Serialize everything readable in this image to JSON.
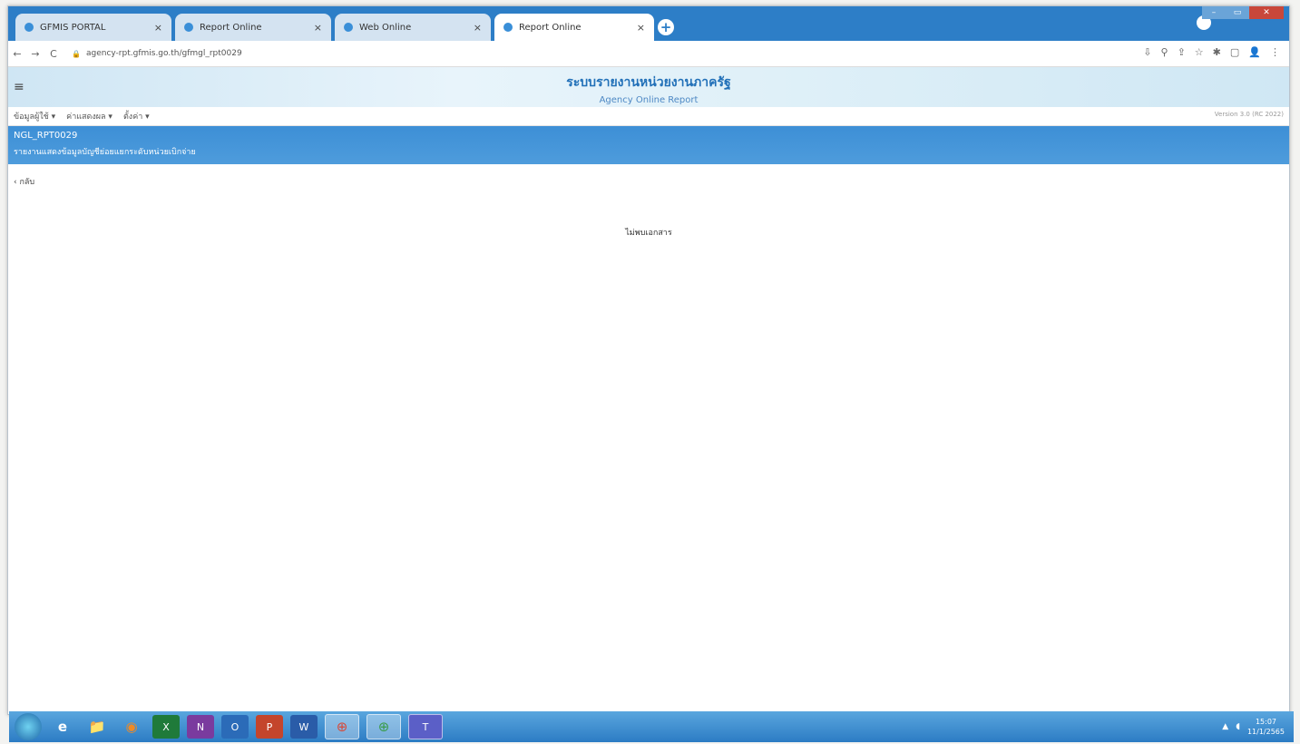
{
  "browser": {
    "tabs": [
      {
        "label": "GFMIS PORTAL",
        "active": false
      },
      {
        "label": "Report Online",
        "active": false
      },
      {
        "label": "Web Online",
        "active": false
      },
      {
        "label": "Report Online",
        "active": true
      }
    ],
    "tab_close": "×",
    "new_tab": "+",
    "url": "agency-rpt.gfmis.go.th/gfmgl_rpt0029",
    "nav": {
      "back": "←",
      "forward": "→",
      "reload": "C"
    },
    "lock_icon": "🔒",
    "toolbar_icons": [
      "⇩",
      "⚲",
      "⇪",
      "☆",
      "✱",
      "▢",
      "👤",
      "⋮"
    ],
    "window_controls": {
      "min": "–",
      "max": "▭",
      "close": "✕"
    }
  },
  "app": {
    "menu_icon": "≡",
    "title": "ระบบรายงานหน่วยงานภาครัฐ",
    "subtitle": "Agency Online Report",
    "menu": [
      "ข้อมูลผู้ใช้ ▾",
      "ค่าแสดงผล ▾",
      "ตั้งค่า ▾"
    ],
    "version": "Version 3.0 (RC 2022)",
    "report_code": "NGL_RPT0029",
    "report_name": "รายงานแสดงข้อมูลบัญชีย่อยแยกระดับหน่วยเบิกจ่าย",
    "back_label": "‹ กลับ",
    "empty_message": "ไม่พบเอกสาร"
  },
  "taskbar": {
    "apps": [
      "e",
      "📁",
      "◉",
      "X",
      "N",
      "O",
      "P",
      "W",
      "⊕",
      "⊕",
      "T"
    ],
    "clock_time": "15:07",
    "clock_date": "11/1/2565"
  },
  "colors": {
    "brand_blue": "#2d7ec7",
    "banner_blue": "#4e9cdc",
    "title_blue": "#2170b8"
  }
}
